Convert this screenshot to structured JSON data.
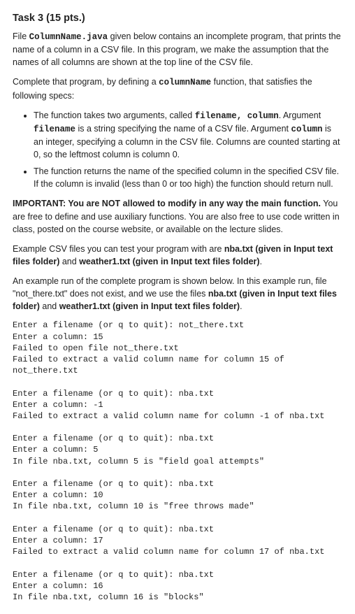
{
  "title": "Task 3 (15 pts.)",
  "para1": {
    "pre": "File ",
    "file": "ColumnName.java",
    "post": " given below contains an incomplete program, that prints the name of a column in a CSV file. In this program, we make the assumption that the names of all columns are shown at the top line of the CSV file."
  },
  "para2": {
    "pre": "Complete that program, by defining a ",
    "fn": "columnName",
    "post": " function, that satisfies the following specs:"
  },
  "bullet1": {
    "a": "The function takes two arguments, called ",
    "args": "filename, column",
    "b": ". Argument ",
    "arg1": "filename",
    "c": " is a string specifying the name of a CSV file. Argument ",
    "arg2": "column",
    "d": " is an integer, specifying a column in the CSV file. Columns are counted starting at 0, so the leftmost column is column 0."
  },
  "bullet2": "The function returns the name of the specified column in the specified CSV file. If the column is invalid (less than 0 or too high) the function should return null.",
  "important": {
    "strong": "IMPORTANT: You are NOT allowed to modify in any way the main function.",
    "rest": " You are free to define and use auxiliary functions. You are also free to use code written in class, posted on the course website, or available on the lecture slides."
  },
  "example_files": {
    "a": "Example CSV files you can test your program with are ",
    "f1": "nba.txt (given in Input text files folder)",
    "mid": " and ",
    "f2": "weather1.txt (given in Input text files folder)",
    "end": "."
  },
  "example_run": {
    "a": "An example run of the complete program is shown below. In this example run, file \"not_there.txt\" does not exist, and we use the files ",
    "f1": "nba.txt (given in Input text files folder)",
    "mid": " and ",
    "f2": "weather1.txt (given in Input text files folder)",
    "end": "."
  },
  "console": "Enter a filename (or q to quit): not_there.txt\nEnter a column: 15\nFailed to open file not_there.txt\nFailed to extract a valid column name for column 15 of not_there.txt\n\nEnter a filename (or q to quit): nba.txt\nEnter a column: -1\nFailed to extract a valid column name for column -1 of nba.txt\n\nEnter a filename (or q to quit): nba.txt\nEnter a column: 5\nIn file nba.txt, column 5 is \"field goal attempts\"\n\nEnter a filename (or q to quit): nba.txt\nEnter a column: 10\nIn file nba.txt, column 10 is \"free throws made\"\n\nEnter a filename (or q to quit): nba.txt\nEnter a column: 17\nFailed to extract a valid column name for column 17 of nba.txt\n\nEnter a filename (or q to quit): nba.txt\nEnter a column: 16\nIn file nba.txt, column 16 is \"blocks\""
}
